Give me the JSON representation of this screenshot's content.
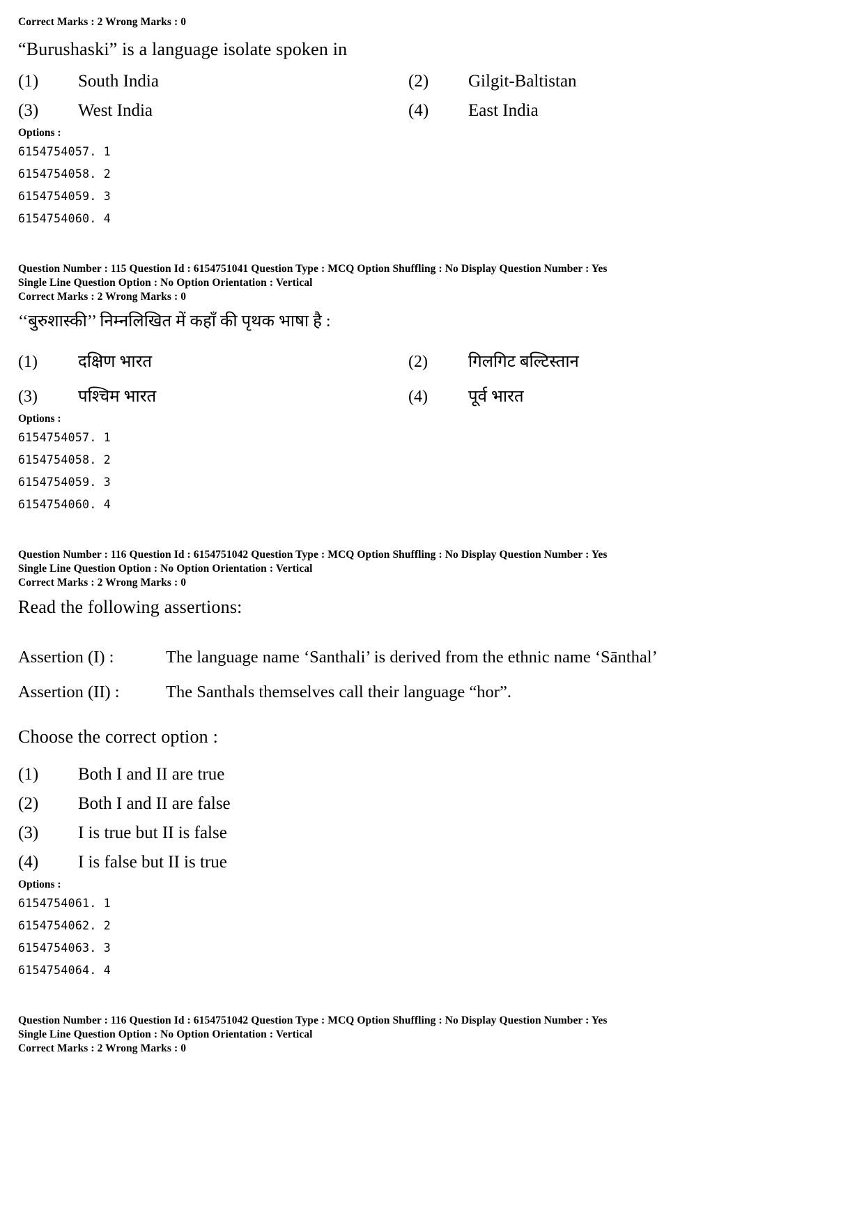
{
  "page": {
    "background": "#ffffff",
    "text_color": "#000000"
  },
  "blocks": {
    "q115_en": {
      "marks_line": "Correct Marks : 2  Wrong Marks : 0",
      "question_text": "“Burushaski” is a language isolate spoken in",
      "choices": [
        {
          "num": "(1)",
          "label": "South India"
        },
        {
          "num": "(2)",
          "label": "Gilgit-Baltistan"
        },
        {
          "num": "(3)",
          "label": "West India"
        },
        {
          "num": "(4)",
          "label": "East India"
        }
      ],
      "options_heading": "Options :",
      "option_ids": [
        "6154754057. 1",
        "6154754058. 2",
        "6154754059. 3",
        "6154754060. 4"
      ]
    },
    "q115_meta": {
      "line1": "Question Number : 115  Question Id : 6154751041  Question Type : MCQ  Option Shuffling : No  Display Question Number : Yes",
      "line2": "Single Line Question Option : No  Option Orientation : Vertical",
      "line3": "Correct Marks : 2  Wrong Marks : 0"
    },
    "q115_hi": {
      "question_text": "‘‘बुरुशास्की’’ निम्नलिखित में कहाँ की पृथक भाषा है :",
      "choices": [
        {
          "num": "(1)",
          "label": "दक्षिण भारत"
        },
        {
          "num": "(2)",
          "label": "गिलगिट बल्टिस्तान"
        },
        {
          "num": "(3)",
          "label": "पश्चिम भारत"
        },
        {
          "num": "(4)",
          "label": "पूर्व भारत"
        }
      ],
      "options_heading": "Options :",
      "option_ids": [
        "6154754057. 1",
        "6154754058. 2",
        "6154754059. 3",
        "6154754060. 4"
      ]
    },
    "q116_meta": {
      "line1": "Question Number : 116  Question Id : 6154751042  Question Type : MCQ  Option Shuffling : No  Display Question Number : Yes",
      "line2": "Single Line Question Option : No  Option Orientation : Vertical",
      "line3": "Correct Marks : 2  Wrong Marks : 0"
    },
    "q116_en": {
      "intro": "Read the following assertions:",
      "assertions": [
        {
          "key": "Assertion (I) :",
          "value": "The language name ‘Santhali’ is derived from the ethnic name ‘Sānthal’"
        },
        {
          "key": "Assertion (II) :",
          "value": "The Santhals themselves call their language “hor”."
        }
      ],
      "prompt": "Choose the correct option :",
      "choices": [
        {
          "num": "(1)",
          "label": "Both I and II are true"
        },
        {
          "num": "(2)",
          "label": "Both I and II are false"
        },
        {
          "num": "(3)",
          "label": "I is true but II is false"
        },
        {
          "num": "(4)",
          "label": "I is false but II is true"
        }
      ],
      "options_heading": "Options :",
      "option_ids": [
        "6154754061. 1",
        "6154754062. 2",
        "6154754063. 3",
        "6154754064. 4"
      ]
    },
    "q116_meta_footer": {
      "line1": "Question Number : 116  Question Id : 6154751042  Question Type : MCQ  Option Shuffling : No  Display Question Number : Yes",
      "line2": "Single Line Question Option : No  Option Orientation : Vertical",
      "line3": "Correct Marks : 2  Wrong Marks : 0"
    }
  }
}
